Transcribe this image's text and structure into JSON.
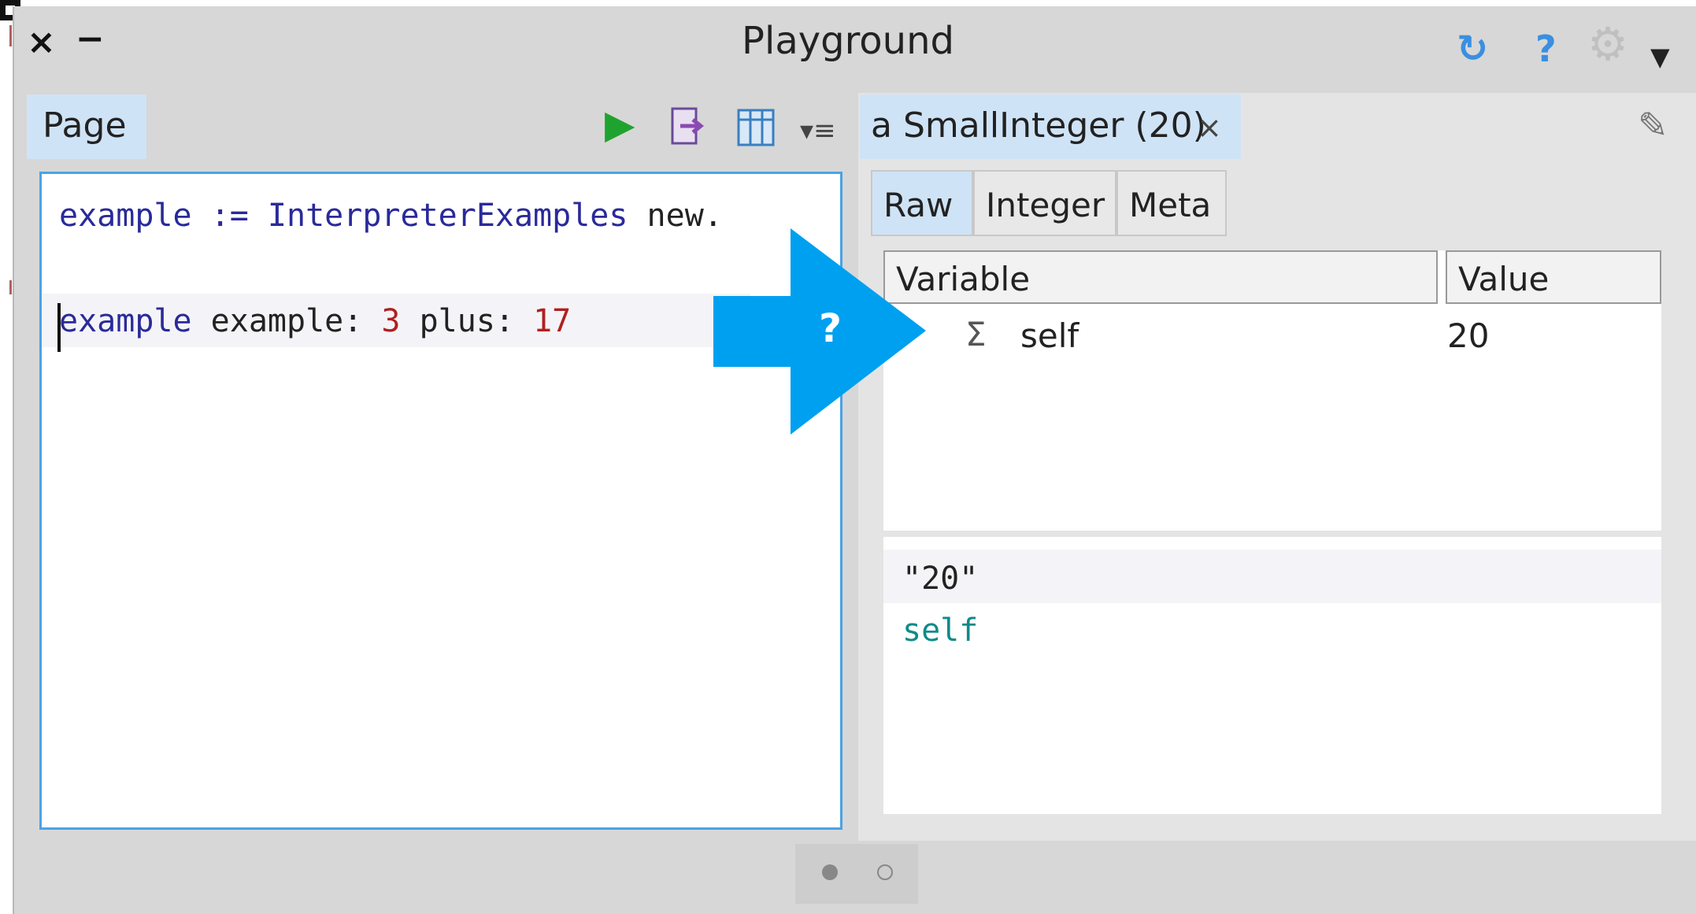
{
  "window": {
    "title": "Playground",
    "controls": {
      "close": "×",
      "minimize": "−"
    },
    "toolbar_icons": [
      "sync-icon",
      "help-icon",
      "gear-icon",
      "menu-down-icon"
    ]
  },
  "left_pane": {
    "tab_label": "Page",
    "actions": [
      "run-icon",
      "doit-icon",
      "columns-icon",
      "more-icon"
    ],
    "code": {
      "line1": {
        "receiver": "example :=",
        "class_name": " InterpreterExamples",
        "msg": " new."
      },
      "line2": {
        "receiver": "example",
        "msg1": " example: ",
        "arg1": "3",
        "msg2": " plus: ",
        "arg2": "17"
      }
    }
  },
  "right_pane": {
    "tab_label": "a SmallInteger (20)",
    "close_glyph": "×",
    "subtabs": [
      "Raw",
      "Integer",
      "Meta"
    ],
    "active_subtab": "Raw",
    "table": {
      "columns": [
        "Variable",
        "Value"
      ],
      "rows": [
        {
          "icon": "sigma-icon",
          "glyph": "Σ",
          "name": "self",
          "value": "20"
        }
      ]
    },
    "evaluator": {
      "line1": "\"20\"",
      "line2": "self"
    }
  },
  "overlay": {
    "label": "?",
    "color": "#00a0f0"
  },
  "pager": {
    "pages": 2,
    "current": 1
  },
  "colors": {
    "accent": "#4aa3e6",
    "tab_active": "#cfe3f6",
    "run_green": "#1fa32f",
    "literal": "#b02020",
    "keyword": "#2a2a9a"
  }
}
